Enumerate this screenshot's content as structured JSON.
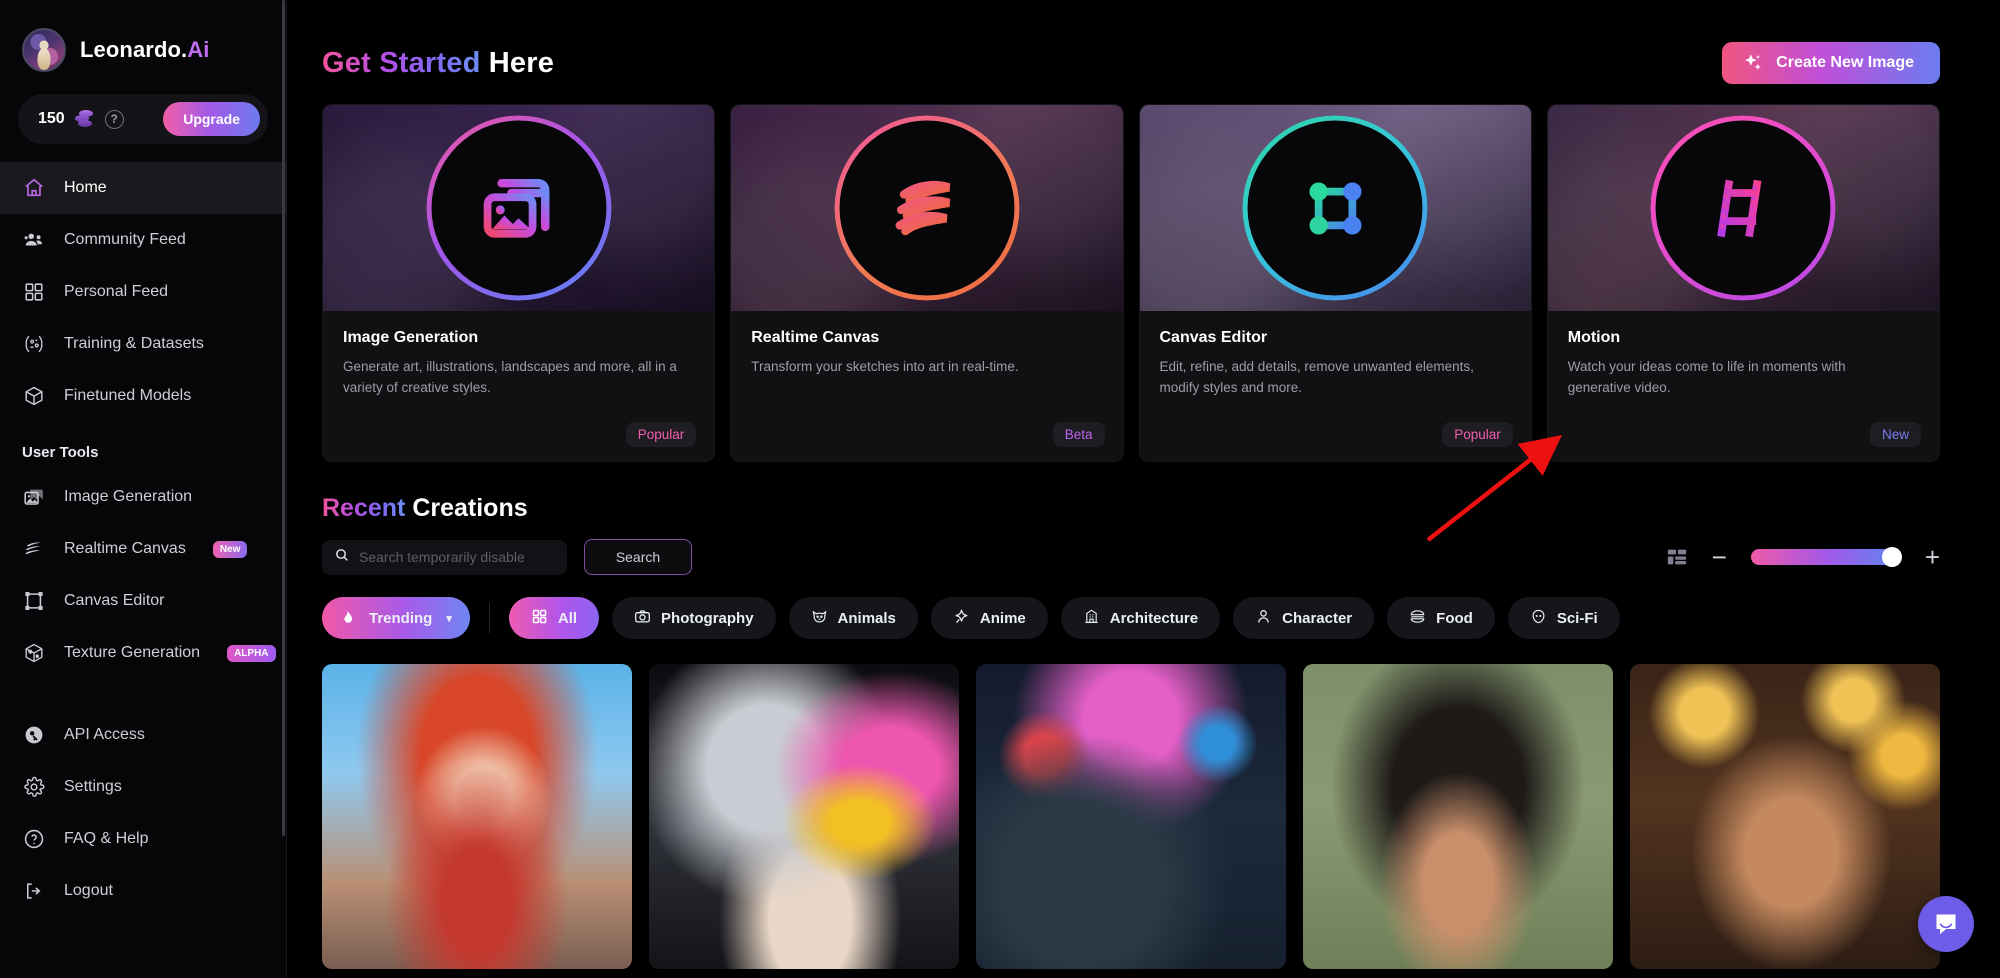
{
  "brand": {
    "name": "Leonardo.",
    "suffix": "Ai",
    "avatar_icon": "user-avatar"
  },
  "credits": {
    "amount": "150",
    "coin_icon": "coins-icon",
    "help_icon": "help-circle-icon",
    "upgrade_label": "Upgrade"
  },
  "sidebar": {
    "items": [
      {
        "label": "Home",
        "icon": "home-icon",
        "active": true
      },
      {
        "label": "Community Feed",
        "icon": "people-icon",
        "active": false
      },
      {
        "label": "Personal Feed",
        "icon": "grid-icon",
        "active": false
      },
      {
        "label": "Training & Datasets",
        "icon": "training-icon",
        "active": false
      },
      {
        "label": "Finetuned Models",
        "icon": "cube-icon",
        "active": false
      }
    ],
    "section_label": "User Tools",
    "tools": [
      {
        "label": "Image Generation",
        "icon": "images-icon",
        "badge": ""
      },
      {
        "label": "Realtime Canvas",
        "icon": "realtime-icon",
        "badge": "New"
      },
      {
        "label": "Canvas Editor",
        "icon": "canvas-icon",
        "badge": ""
      },
      {
        "label": "Texture Generation",
        "icon": "texture-icon",
        "badge": "ALPHA"
      }
    ],
    "footer": [
      {
        "label": "API Access",
        "icon": "key-icon"
      },
      {
        "label": "Settings",
        "icon": "gear-icon"
      },
      {
        "label": "FAQ & Help",
        "icon": "question-icon"
      },
      {
        "label": "Logout",
        "icon": "logout-icon"
      }
    ]
  },
  "header": {
    "title_accent": "Get Started",
    "title_rest": " Here",
    "create_button": "Create New Image",
    "create_icon": "sparkles-icon"
  },
  "feature_cards": [
    {
      "title": "Image Generation",
      "description": "Generate art, illustrations, landscapes and more, all in a variety of creative styles.",
      "tag": "Popular",
      "tag_type": "popular",
      "icon": "image-stack-icon"
    },
    {
      "title": "Realtime Canvas",
      "description": "Transform your sketches into art in real-time.",
      "tag": "Beta",
      "tag_type": "beta",
      "icon": "realtime-swoosh-icon"
    },
    {
      "title": "Canvas Editor",
      "description": "Edit, refine, add details, remove unwanted elements, modify styles and more.",
      "tag": "Popular",
      "tag_type": "popular",
      "icon": "bounding-box-icon"
    },
    {
      "title": "Motion",
      "description": "Watch your ideas come to life in moments with generative video.",
      "tag": "New",
      "tag_type": "new",
      "icon": "film-strip-icon"
    }
  ],
  "recent": {
    "title_accent": "Recent",
    "title_rest": " Creations",
    "search_placeholder": "Search temporarily disable",
    "search_value": "",
    "search_button": "Search",
    "search_icon": "search-icon",
    "grid_toggle_icon": "layout-toggle-icon",
    "zoom_out_label": "−",
    "zoom_in_label": "+",
    "zoom_value": "100"
  },
  "filters": {
    "sort": {
      "label": "Trending",
      "icon": "flame-icon",
      "caret": "▾"
    },
    "chips": [
      {
        "label": "All",
        "icon": "grid-small-icon",
        "active": true
      },
      {
        "label": "Photography",
        "icon": "camera-icon",
        "active": false
      },
      {
        "label": "Animals",
        "icon": "cat-icon",
        "active": false
      },
      {
        "label": "Anime",
        "icon": "anime-star-icon",
        "active": false
      },
      {
        "label": "Architecture",
        "icon": "building-icon",
        "active": false
      },
      {
        "label": "Character",
        "icon": "person-icon",
        "active": false
      },
      {
        "label": "Food",
        "icon": "burger-icon",
        "active": false
      },
      {
        "label": "Sci-Fi",
        "icon": "alien-icon",
        "active": false
      }
    ]
  },
  "gallery": [
    {
      "alt": "Red-haired anime woman in stadium",
      "cls": "g1"
    },
    {
      "alt": "Silver-haired figure with colorful paint splashes",
      "cls": "g2"
    },
    {
      "alt": "Blue cat in front of Christmas tree",
      "cls": "g3"
    },
    {
      "alt": "Woman with large curly afro on green background",
      "cls": "g4"
    },
    {
      "alt": "Smiling woman with string lights background",
      "cls": "g5"
    }
  ],
  "annotation": {
    "type": "arrow",
    "color": "#ee1111"
  },
  "chat": {
    "icon": "chat-bubble-icon",
    "color": "#6c5ce7"
  },
  "colors": {
    "accent_pink": "#f2559b",
    "accent_purple": "#a25ae6",
    "accent_blue": "#6d7bf0",
    "background": "#000000",
    "sidebar_bg": "#060608",
    "card_bg": "#111114"
  }
}
